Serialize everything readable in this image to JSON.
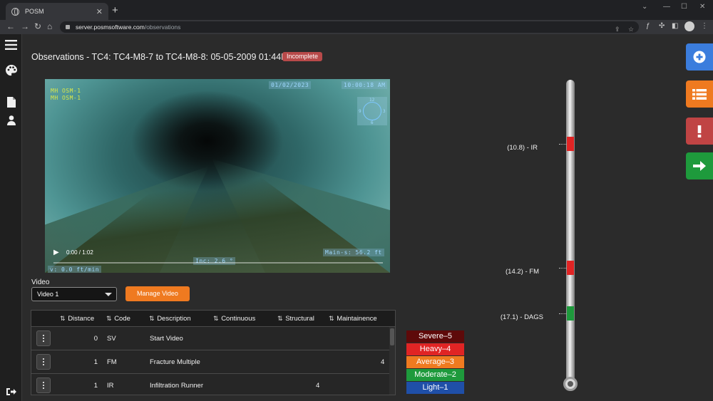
{
  "browser": {
    "tab_title": "POSM",
    "url_host": "server.posmsoftware.com",
    "url_path": "/observations"
  },
  "page": {
    "title": "Observations - TC4: TC4-M8-7 to TC4-M8-8: 05-05-2009 01:44PM",
    "status_badge": "Incomplete",
    "status_color": "#b84a4a"
  },
  "video_player": {
    "overlay_mh1": "MH OSM-1",
    "overlay_mh2": "MH OSM-1",
    "overlay_date": "01/02/2023",
    "overlay_time": "10:00:18 AM",
    "dial_12": "12",
    "dial_3": "3",
    "dial_6": "6",
    "dial_9": "9",
    "overlay_main": "Main-s:  56.2 ft",
    "overlay_inc": "Inc:   2.6 °",
    "overlay_speed": "v:  0.0 ft/min",
    "time_display": "0:00 / 1:02",
    "progress": 0
  },
  "video_select": {
    "label": "Video",
    "value": "Video 1"
  },
  "manage_video_label": "Manage Video",
  "table": {
    "headers": {
      "distance": "Distance",
      "code": "Code",
      "description": "Description",
      "continuous": "Continuous",
      "structural": "Structural",
      "maintainence": "Maintainence"
    },
    "rows": [
      {
        "distance": "0",
        "code": "SV",
        "description": "Start Video",
        "structural": "",
        "maintainence": ""
      },
      {
        "distance": "1",
        "code": "FM",
        "description": "Fracture Multiple",
        "structural": "",
        "maintainence": "4"
      },
      {
        "distance": "1",
        "code": "IR",
        "description": "Infiltration Runner",
        "structural": "4",
        "maintainence": ""
      }
    ]
  },
  "legend": [
    {
      "label": "Severe–5",
      "color": "#5e0a0a"
    },
    {
      "label": "Heavy–4",
      "color": "#e02424"
    },
    {
      "label": "Average–3",
      "color": "#ef7a20"
    },
    {
      "label": "Moderate–2",
      "color": "#1e9a3c"
    },
    {
      "label": "Light–1",
      "color": "#1f4fa8"
    }
  ],
  "pipe_markers": [
    {
      "label": "(10.8) - IR",
      "color": "#e02424"
    },
    {
      "label": "(14.2) - FM",
      "color": "#e02424"
    },
    {
      "label": "(17.1) - DAGS",
      "color": "#1e9a3c"
    }
  ],
  "actions": [
    {
      "icon": "plus-circle-icon",
      "color": "#3b7ddd"
    },
    {
      "icon": "list-icon",
      "color": "#ef7a20"
    },
    {
      "icon": "exclamation-icon",
      "color": "#c04444"
    },
    {
      "icon": "arrow-right-icon",
      "color": "#1e9a3c"
    }
  ]
}
